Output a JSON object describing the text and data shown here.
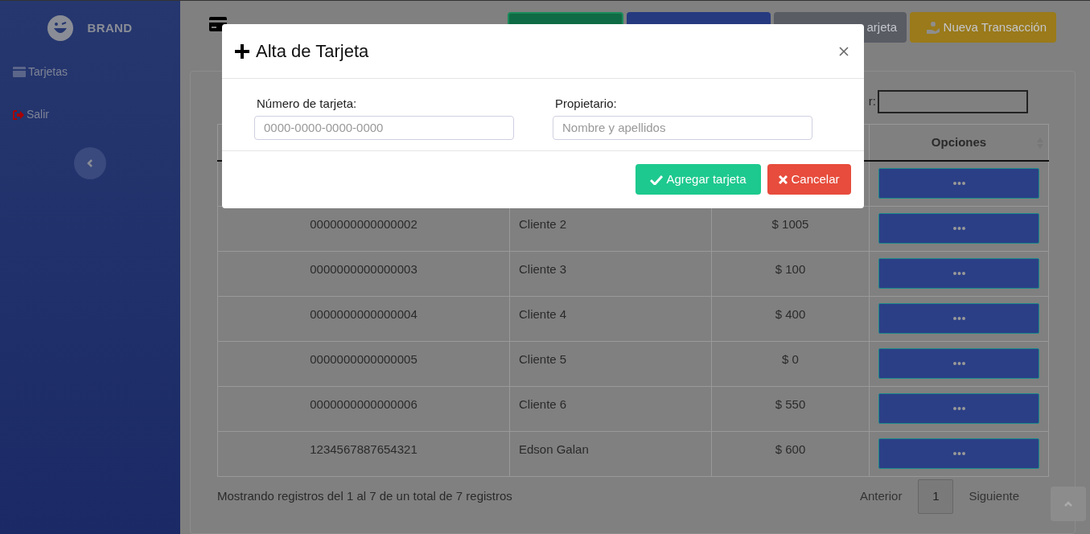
{
  "sidebar": {
    "brand": "BRAND",
    "items": [
      {
        "label": "Tarjetas",
        "kind": "card"
      },
      {
        "label": "Salir",
        "kind": "exit"
      }
    ]
  },
  "header_buttons": [
    {
      "kind": "green"
    },
    {
      "kind": "blue"
    },
    {
      "label": "arjeta",
      "kind": "gray"
    },
    {
      "label": "Nueva Transacción",
      "kind": "yellow"
    }
  ],
  "search": {
    "label": "r:"
  },
  "table": {
    "columns": [
      {
        "label": "Opciones"
      }
    ],
    "rows": [
      {
        "kind": "covered"
      },
      {
        "kind": "data",
        "number": "0000000000000002",
        "owner": "Cliente 2",
        "balance": "$ 1005"
      },
      {
        "kind": "data",
        "number": "0000000000000003",
        "owner": "Cliente 3",
        "balance": "$ 100"
      },
      {
        "kind": "data",
        "number": "0000000000000004",
        "owner": "Cliente 4",
        "balance": "$ 400"
      },
      {
        "kind": "data",
        "number": "0000000000000005",
        "owner": "Cliente 5",
        "balance": "$ 0"
      },
      {
        "kind": "data",
        "number": "0000000000000006",
        "owner": "Cliente 6",
        "balance": "$ 550"
      },
      {
        "kind": "data",
        "number": "1234567887654321",
        "owner": "Edson Galan",
        "balance": "$ 600"
      }
    ]
  },
  "footer": {
    "info": "Mostrando registros del 1 al 7 de un total de 7 registros",
    "prev": "Anterior",
    "page": "1",
    "next": "Siguiente"
  },
  "dialog": {
    "title": "Alta de Tarjeta",
    "fields": [
      {
        "label": "Número de tarjeta:",
        "placeholder": "0000-0000-0000-0000"
      },
      {
        "label": "Propietario:",
        "placeholder": "Nombre y apellidos"
      }
    ],
    "buttons": [
      {
        "label": "Agregar tarjeta",
        "kind": "confirm"
      },
      {
        "label": "Cancelar",
        "kind": "cancel"
      }
    ]
  }
}
